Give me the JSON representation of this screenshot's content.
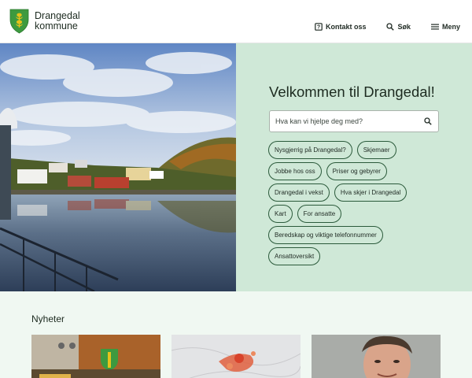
{
  "header": {
    "logo_line1": "Drangedal",
    "logo_line2": "kommune",
    "nav": {
      "contact": "Kontakt oss",
      "search": "Søk",
      "menu": "Meny"
    }
  },
  "hero": {
    "title": "Velkommen til Drangedal!",
    "search_placeholder": "Hva kan vi hjelpe deg med?",
    "quicklinks": [
      "Nysgjerrig på Drangedal?",
      "Skjemaer",
      "Jobbe hos oss",
      "Priser og gebyrer",
      "Drangedal i vekst",
      "Hva skjer i Drangedal",
      "Kart",
      "For ansatte",
      "Beredskap og viktige telefonnummer",
      "Ansattoversikt"
    ]
  },
  "news": {
    "heading": "Nyheter"
  },
  "colors": {
    "brand_green": "#2b5a3b",
    "panel_bg": "#cfe8d7",
    "news_bg": "#f0f8f2",
    "shield_green": "#3d9a3f",
    "shield_gold": "#e6c21a"
  },
  "icons": [
    "coat-of-arms-icon",
    "contact-icon",
    "search-icon",
    "menu-icon"
  ]
}
